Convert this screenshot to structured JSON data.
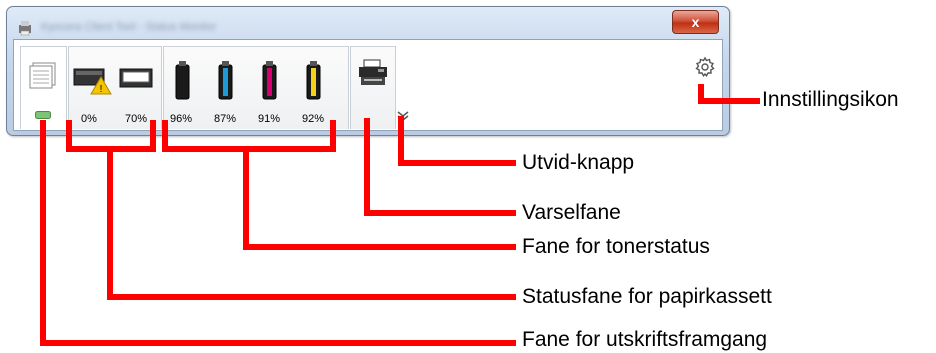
{
  "window": {
    "title": "Kyocera Client Tool - Status Monitor",
    "close_label": "x"
  },
  "tabs": {
    "print_progress": {
      "name": "print-progress-tab"
    },
    "paper_cassette": {
      "values": [
        "0%",
        "70%"
      ]
    },
    "toner": {
      "values": [
        "96%",
        "87%",
        "91%",
        "92%"
      ],
      "colors": [
        "#1a1a1a",
        "#1e9ad6",
        "#d6006f",
        "#f2d21b"
      ]
    },
    "alert": {
      "name": "alert-tab"
    }
  },
  "callouts": {
    "settings_icon": "Innstillingsikon",
    "expand_button": "Utvid-knapp",
    "alert_tab": "Varselfane",
    "toner_tab": "Fane for tonerstatus",
    "paper_tab": "Statusfane for papirkassett",
    "progress_tab": "Fane for utskriftsframgang"
  },
  "colors": {
    "callout_line": "#ff0000",
    "window_frame": "#c6d7ec"
  }
}
